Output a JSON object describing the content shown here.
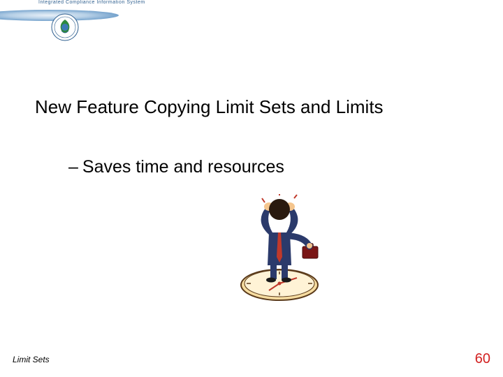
{
  "header": {
    "brand_text": "Integrated Compliance Information System"
  },
  "title": "New Feature Copying Limit Sets and Limits",
  "bullets": [
    {
      "dash": "–",
      "text": "Saves time and resources"
    }
  ],
  "clipart": {
    "name": "frustrated-person-on-clock"
  },
  "footer": {
    "left": "Limit Sets",
    "page_number": "60"
  }
}
